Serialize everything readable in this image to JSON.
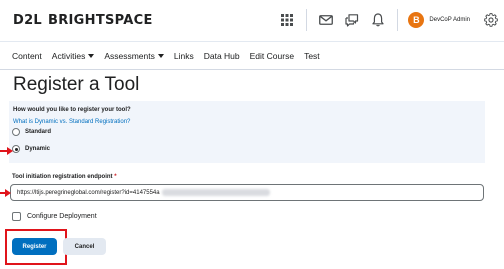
{
  "header": {
    "brand_prefix": "D2L",
    "brand_name": "BRIGHTSPACE",
    "user_initial": "B",
    "user_name": "DevCoP Admin"
  },
  "nav": {
    "items": [
      {
        "label": "Content",
        "dropdown": false
      },
      {
        "label": "Activities",
        "dropdown": true
      },
      {
        "label": "Assessments",
        "dropdown": true
      },
      {
        "label": "Links",
        "dropdown": false
      },
      {
        "label": "Data Hub",
        "dropdown": false
      },
      {
        "label": "Edit Course",
        "dropdown": false
      },
      {
        "label": "Test",
        "dropdown": false
      }
    ]
  },
  "page": {
    "title": "Register a Tool"
  },
  "registration": {
    "question": "How would you like to register your tool?",
    "help_link": "What is Dynamic vs. Standard Registration?",
    "options": [
      {
        "label": "Standard",
        "selected": false
      },
      {
        "label": "Dynamic",
        "selected": true
      }
    ]
  },
  "endpoint": {
    "label": "Tool initiation registration endpoint",
    "required_marker": "*",
    "value": "https://ltijs.peregrineglobal.com/register?id=4147554a"
  },
  "configure": {
    "label": "Configure Deployment",
    "checked": false
  },
  "actions": {
    "register_label": "Register",
    "cancel_label": "Cancel"
  },
  "colors": {
    "primary": "#006fbf",
    "annotation_red": "#e0141b",
    "avatar": "#e87511",
    "panel_bg": "#f1f5fb"
  }
}
